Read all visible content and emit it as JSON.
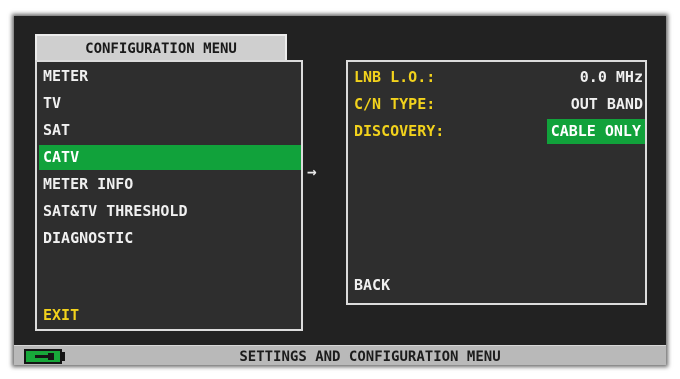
{
  "config_menu": {
    "title": "CONFIGURATION MENU",
    "items": [
      {
        "label": "METER",
        "selected": false
      },
      {
        "label": "TV",
        "selected": false
      },
      {
        "label": "SAT",
        "selected": false
      },
      {
        "label": "CATV",
        "selected": true
      },
      {
        "label": "METER INFO",
        "selected": false
      },
      {
        "label": "SAT&TV THRESHOLD",
        "selected": false
      },
      {
        "label": "DIAGNOSTIC",
        "selected": false
      }
    ],
    "exit_label": "EXIT"
  },
  "submenu_arrow_icon": "right-arrow-icon",
  "catv_panel": {
    "rows": [
      {
        "label": "LNB L.O.:",
        "value": "0.0 MHz"
      },
      {
        "label": "C/N TYPE:",
        "value": "OUT BAND"
      },
      {
        "label": "DISCOVERY:",
        "value": "CABLE ONLY"
      }
    ],
    "back_label": "BACK"
  },
  "status_bar": {
    "text": "SETTINGS AND CONFIGURATION MENU",
    "battery_icon": "battery-icon"
  },
  "colors": {
    "highlight": "#11a23b",
    "label_yellow": "#f2d21c",
    "panel_bg": "#2e2e2e",
    "screen_bg": "#222222"
  }
}
